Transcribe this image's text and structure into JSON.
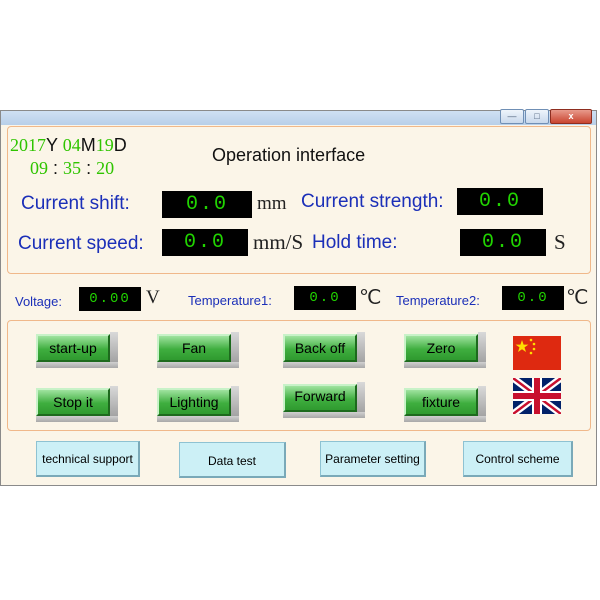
{
  "window": {
    "close_label": "x",
    "title": "Operation interface"
  },
  "datetime": {
    "year": "2017",
    "year_unit": "Y",
    "month": "04",
    "month_unit": "M",
    "day": "19",
    "day_unit": "D",
    "hour": "09",
    "minute": "35",
    "second": "20",
    "separator": ":"
  },
  "readouts": {
    "current_shift": {
      "label": "Current shift:",
      "value": "0.0",
      "unit": "mm"
    },
    "current_strength": {
      "label": "Current strength:",
      "value": "0.0"
    },
    "current_speed": {
      "label": "Current speed:",
      "value": "0.0",
      "unit": "mm/S"
    },
    "hold_time": {
      "label": "Hold time:",
      "value": "0.0",
      "unit": "S"
    }
  },
  "sensors": {
    "voltage": {
      "label": "Voltage:",
      "value": "0.00",
      "unit": "V"
    },
    "temperature1": {
      "label": "Temperature1:",
      "value": "0.0",
      "unit": "℃"
    },
    "temperature2": {
      "label": "Temperature2:",
      "value": "0.0",
      "unit": "℃"
    }
  },
  "controls": {
    "startup": "start-up",
    "fan": "Fan",
    "back_off": "Back off",
    "zero": "Zero",
    "stop_it": "Stop it",
    "lighting": "Lighting",
    "forward": "Forward",
    "fixture": "fixture"
  },
  "language_flags": [
    "china-flag-icon",
    "uk-flag-icon"
  ],
  "bottom_buttons": {
    "technical_support": "technical support",
    "data_test": "Data test",
    "parameter_setting": "Parameter setting",
    "control_scheme": "Control scheme"
  },
  "colors": {
    "label_blue": "#1b2fb8",
    "display_green": "#21d400",
    "button_green": "#3fae3f",
    "panel_border": "#f0b88a",
    "bottom_button_bg": "#ccf0f6"
  }
}
